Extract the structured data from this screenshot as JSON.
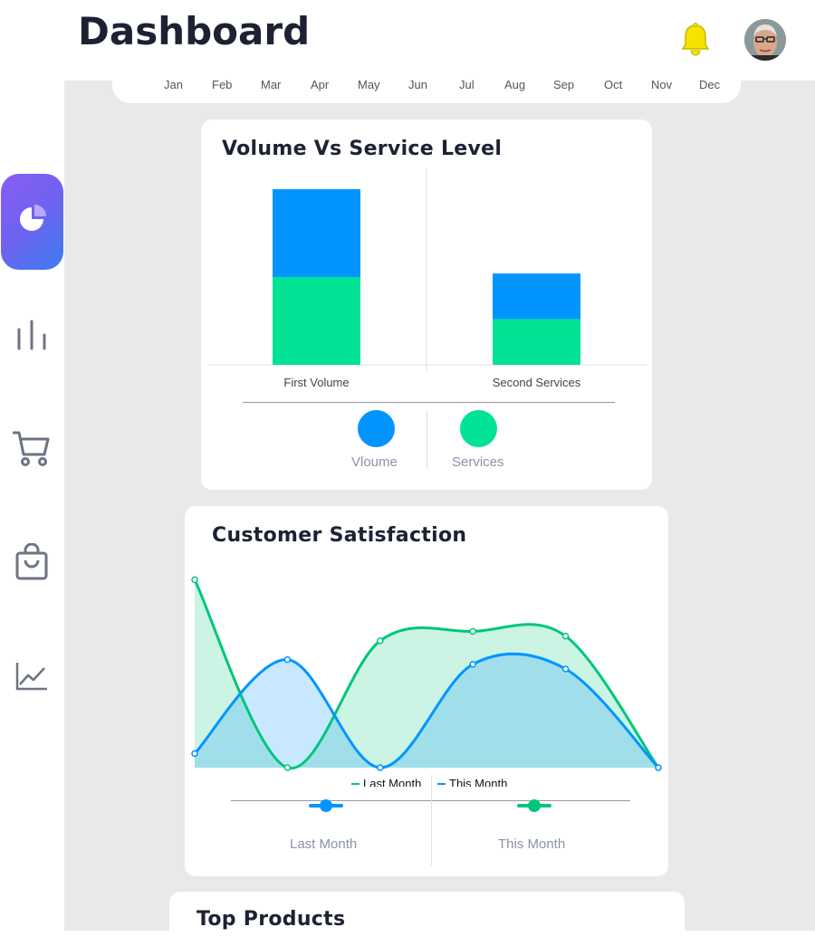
{
  "header": {
    "title": "Dashboard"
  },
  "months": [
    "Jan",
    "Feb",
    "Mar",
    "Apr",
    "May",
    "Jun",
    "Jul",
    "Aug",
    "Sep",
    "Oct",
    "Nov",
    "Dec"
  ],
  "sidebar": {
    "items": [
      {
        "icon": "pie-chart-icon",
        "active": true
      },
      {
        "icon": "bar-chart-icon",
        "active": false
      },
      {
        "icon": "cart-icon",
        "active": false
      },
      {
        "icon": "shopping-bag-icon",
        "active": false
      },
      {
        "icon": "line-chart-icon",
        "active": false
      }
    ]
  },
  "colors": {
    "blue": "#0395ff",
    "green": "#00e394",
    "accent_purple": "#7b61ff",
    "bell": "#f5e300"
  },
  "volume_card": {
    "title": "Volume Vs Service Level",
    "legend": [
      {
        "label": "Vloume",
        "color": "#0395ff"
      },
      {
        "label": "Services",
        "color": "#00e394"
      }
    ],
    "chart_data": {
      "type": "bar",
      "stacked": true,
      "categories": [
        "First Volume",
        "Second Services"
      ],
      "series": [
        {
          "name": "Services",
          "values": [
            100,
            52
          ]
        },
        {
          "name": "Vloume",
          "values": [
            100,
            52
          ]
        }
      ],
      "ylim": [
        0,
        200
      ]
    }
  },
  "satisfaction_card": {
    "title": "Customer Satisfaction",
    "legend": [
      {
        "label": "Last Month",
        "color": "#00c67a"
      },
      {
        "label": "This Month",
        "color": "#0395ff"
      }
    ],
    "controls": [
      {
        "label": "Last Month",
        "color": "#0395ff"
      },
      {
        "label": "This Month",
        "color": "#00c67a"
      }
    ],
    "chart_data": {
      "type": "area",
      "x": [
        1,
        2,
        3,
        4,
        5,
        6
      ],
      "series": [
        {
          "name": "Last Month",
          "values": [
            4.0,
            0.0,
            2.7,
            2.9,
            2.8,
            0.0
          ]
        },
        {
          "name": "This Month",
          "values": [
            0.3,
            2.3,
            0.0,
            2.2,
            2.1,
            0.0
          ]
        }
      ],
      "ylim": [
        0,
        4.2
      ]
    }
  },
  "top_products": {
    "title": "Top Products"
  }
}
